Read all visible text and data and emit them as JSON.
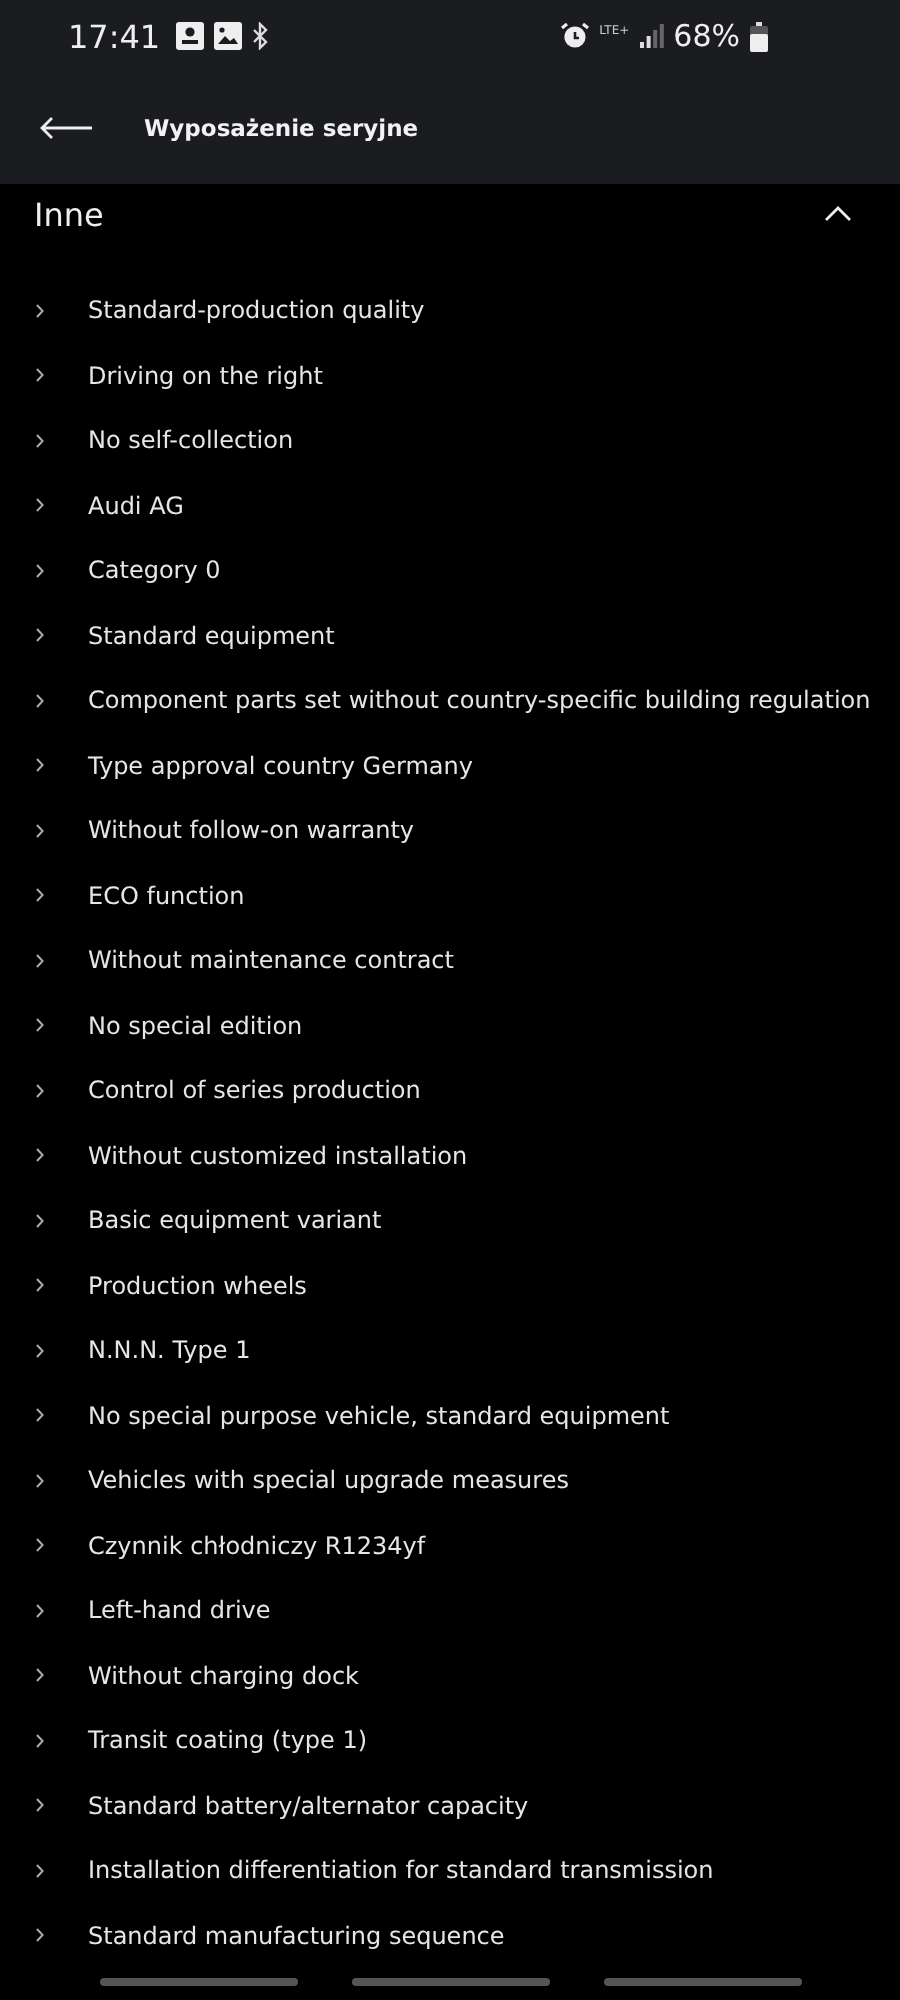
{
  "status_bar": {
    "time": "17:41",
    "network": "LTE+",
    "battery": "68%"
  },
  "header": {
    "title": "Wyposażenie seryjne"
  },
  "section": {
    "title": "Inne",
    "expanded": true,
    "items": [
      "Standard-production quality",
      "Driving on the right",
      "No self-collection",
      "Audi AG",
      "Category 0",
      "Standard equipment",
      "Component parts set without country-specific building regulation",
      "Type approval country Germany",
      "Without follow-on warranty",
      "ECO function",
      "Without maintenance contract",
      "No special edition",
      "Control of series production",
      "Without customized installation",
      "Basic equipment variant",
      "Production wheels",
      "N.N.N. Type 1",
      "No special purpose vehicle, standard equipment",
      "Vehicles with special upgrade measures",
      "Czynnik chłodniczy R1234yf",
      "Left-hand drive",
      "Without charging dock",
      "Transit coating (type 1)",
      "Standard battery/alternator capacity",
      "Installation differentiation for standard transmission",
      "Standard manufacturing sequence"
    ]
  }
}
